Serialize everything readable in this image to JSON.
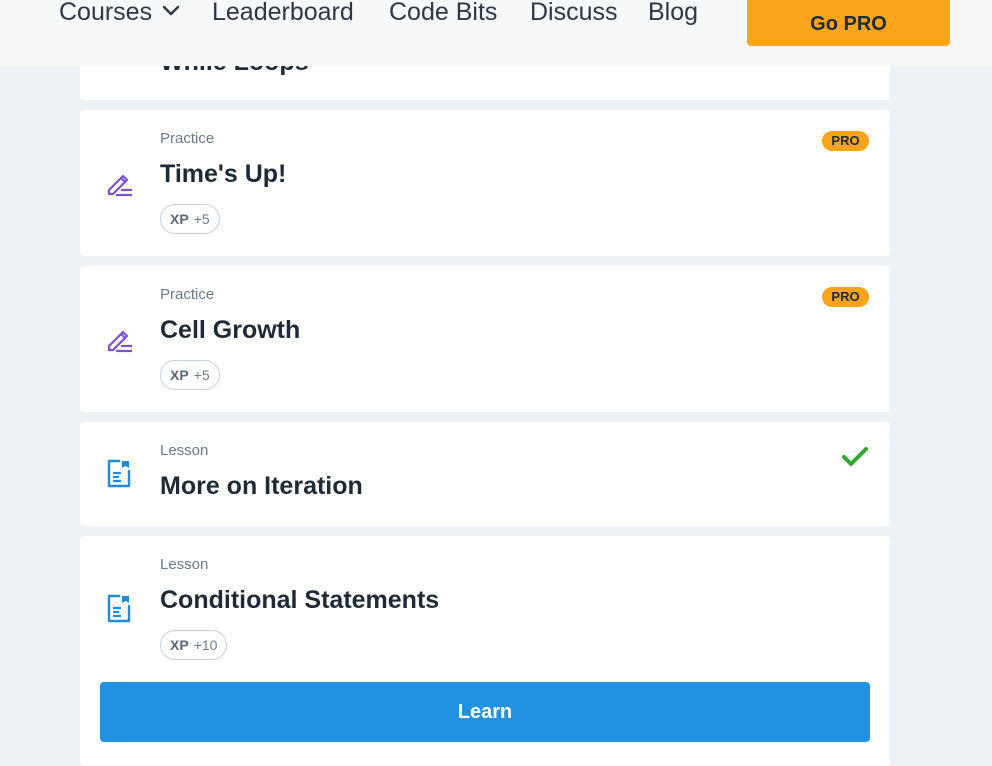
{
  "nav": {
    "items": [
      {
        "label": "Courses"
      },
      {
        "label": "Leaderboard"
      },
      {
        "label": "Code Bits"
      },
      {
        "label": "Discuss"
      },
      {
        "label": "Blog"
      }
    ],
    "go_pro_label": "Go PRO"
  },
  "first_card": {
    "title": "While Loops"
  },
  "cards": [
    {
      "kind": "Practice",
      "title": "Time's Up!",
      "xp_label": "XP",
      "xp_value": "+5",
      "pro_label": "PRO",
      "icon": "pencil-icon"
    },
    {
      "kind": "Practice",
      "title": "Cell Growth",
      "xp_label": "XP",
      "xp_value": "+5",
      "pro_label": "PRO",
      "icon": "pencil-icon"
    },
    {
      "kind": "Lesson",
      "title": "More on Iteration",
      "completed": true,
      "icon": "lesson-icon"
    },
    {
      "kind": "Lesson",
      "title": "Conditional Statements",
      "xp_label": "XP",
      "xp_value": "+10",
      "icon": "lesson-icon",
      "action_label": "Learn"
    }
  ],
  "colors": {
    "accent_orange": "#f9a41b",
    "practice_icon": "#7b4fd6",
    "lesson_icon": "#1f8be0",
    "check_green": "#2fa82f",
    "learn_button": "#2291e0"
  }
}
